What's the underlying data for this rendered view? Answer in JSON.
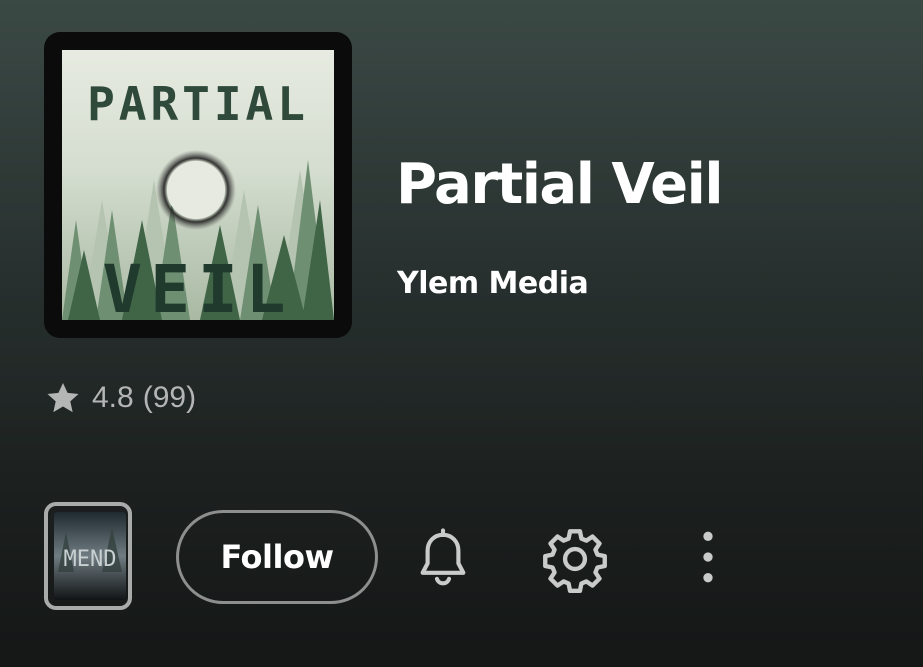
{
  "podcast": {
    "title": "Partial Veil",
    "publisher": "Ylem Media",
    "cover_art": {
      "icon": "podcast-cover-art",
      "text_top": "PARTIAL",
      "text_bottom": "VEIL"
    }
  },
  "rating": {
    "icon": "star-icon",
    "score": "4.8",
    "count": "(99)"
  },
  "actions": {
    "thumbnail_text": "MEND",
    "follow_label": "Follow",
    "notifications_icon": "bell-icon",
    "settings_icon": "gear-icon",
    "more_icon": "more-vertical-icon"
  },
  "colors": {
    "text": "#ffffff",
    "muted_text": "#b4b6b5",
    "icon": "#c9cbca",
    "border": "#8d8f8e"
  }
}
